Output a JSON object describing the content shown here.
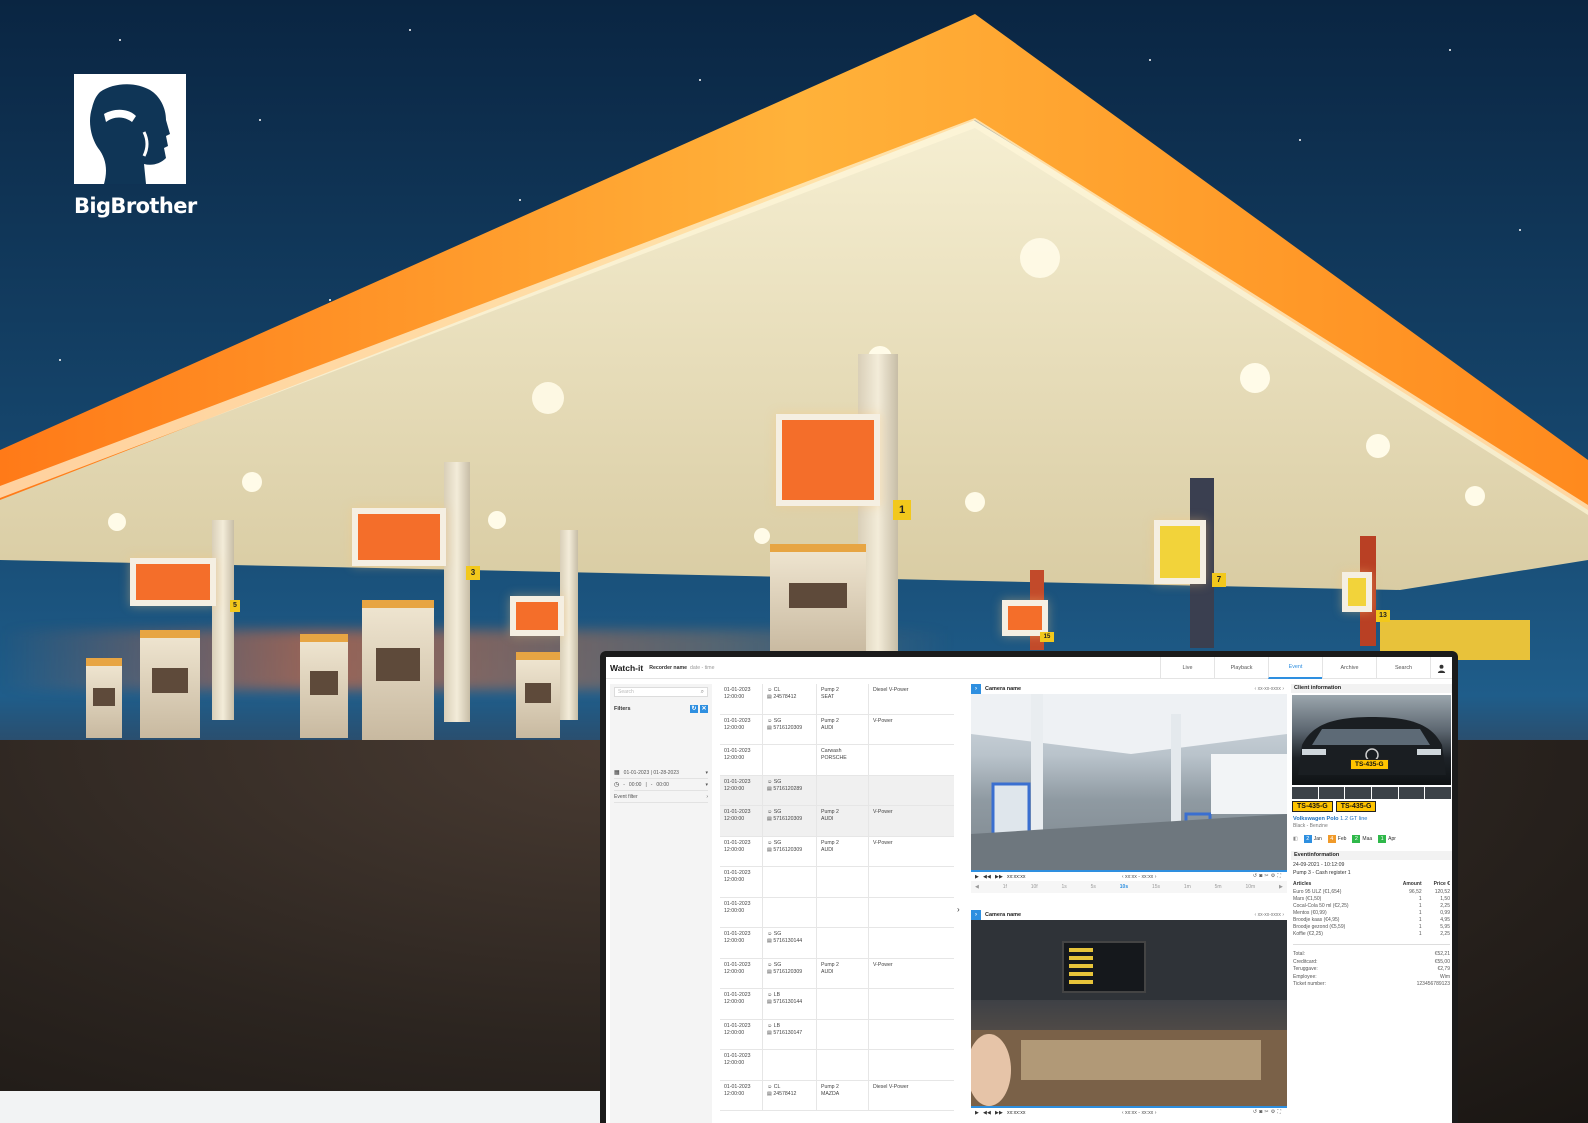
{
  "brand": {
    "logo_name": "BigBrother"
  },
  "scene": {
    "pump_numbers": [
      "1",
      "3",
      "7",
      "13",
      "15",
      "5"
    ]
  },
  "app": {
    "brand": "Watch-it",
    "recorder_name": "Recorder name",
    "recorder_datetime": "date - time",
    "nav": [
      {
        "label": "Live",
        "active": false
      },
      {
        "label": "Playback",
        "active": false
      },
      {
        "label": "Event",
        "active": true
      },
      {
        "label": "Archive",
        "active": false
      },
      {
        "label": "Search",
        "active": false
      }
    ],
    "accent_color": "#2e8fe0",
    "filters": {
      "search_placeholder": "Search",
      "title": "Filters",
      "date_range": "01-01-2023  |  01-28-2023",
      "time_from": "00:00",
      "time_to": "00:00",
      "event_filter": "Event filter"
    },
    "events": [
      {
        "date": "01-01-2023",
        "time": "12:00:00",
        "user": "CL",
        "id": "24578412",
        "pump": "Pump 2",
        "car": "SEAT",
        "fuel": "Diesel V-Power"
      },
      {
        "date": "01-01-2023",
        "time": "12:00:00",
        "user": "SG",
        "id": "5716120309",
        "pump": "Pump 2",
        "car": "AUDI",
        "fuel": "V-Power"
      },
      {
        "date": "01-01-2023",
        "time": "12:00:00",
        "user": "",
        "id": "",
        "pump": "Carwash",
        "car": "PORSCHE",
        "fuel": ""
      },
      {
        "date": "01-01-2023",
        "time": "12:00:00",
        "user": "SG",
        "id": "5716120289",
        "pump": "",
        "car": "",
        "fuel": ""
      },
      {
        "date": "01-01-2023",
        "time": "12:00:00",
        "user": "SG",
        "id": "5716120309",
        "pump": "Pump 2",
        "car": "AUDI",
        "fuel": "V-Power"
      },
      {
        "date": "01-01-2023",
        "time": "12:00:00",
        "user": "SG",
        "id": "5716120309",
        "pump": "Pump 2",
        "car": "AUDI",
        "fuel": "V-Power"
      },
      {
        "date": "01-01-2023",
        "time": "12:00:00",
        "user": "",
        "id": "",
        "pump": "",
        "car": "",
        "fuel": ""
      },
      {
        "date": "01-01-2023",
        "time": "12:00:00",
        "user": "",
        "id": "",
        "pump": "",
        "car": "",
        "fuel": ""
      },
      {
        "date": "01-01-2023",
        "time": "12:00:00",
        "user": "SG",
        "id": "5716130144",
        "pump": "",
        "car": "",
        "fuel": ""
      },
      {
        "date": "01-01-2023",
        "time": "12:00:00",
        "user": "SG",
        "id": "5716120309",
        "pump": "Pump 2",
        "car": "AUDI",
        "fuel": "V-Power"
      },
      {
        "date": "01-01-2023",
        "time": "12:00:00",
        "user": "LB",
        "id": "5716130144",
        "pump": "",
        "car": "",
        "fuel": ""
      },
      {
        "date": "01-01-2023",
        "time": "12:00:00",
        "user": "LB",
        "id": "5716130147",
        "pump": "",
        "car": "",
        "fuel": ""
      },
      {
        "date": "01-01-2023",
        "time": "12:00:00",
        "user": "",
        "id": "",
        "pump": "",
        "car": "",
        "fuel": ""
      },
      {
        "date": "01-01-2023",
        "time": "12:00:00",
        "user": "CL",
        "id": "24578412",
        "pump": "Pump 2",
        "car": "MAZDA",
        "fuel": "Diesel V-Power"
      }
    ],
    "cameras": [
      {
        "name": "Camera name",
        "nav_date": "xx-xx-xxxx",
        "time": "xx:xx:xx",
        "range": "xx:xx - xx:xx"
      },
      {
        "name": "Camera name",
        "nav_date": "xx-xx-xxxx",
        "time": "xx:xx:xx",
        "range": "xx:xx - xx:xx"
      }
    ],
    "scale": [
      "1f",
      "10f",
      "1s",
      "5s",
      "10s",
      "15s",
      "1m",
      "5m",
      "10m"
    ],
    "scale_active": "10s",
    "client": {
      "title": "Client information",
      "plate": "TS-435-G",
      "car_name": "Volkswagen Polo",
      "car_variant": "1.2 GT line",
      "car_sub": "Black - Benzine",
      "visits": [
        {
          "count": "2",
          "month": "Jan",
          "color": "#2e8fe0"
        },
        {
          "count": "4",
          "month": "Feb",
          "color": "#f09a2a"
        },
        {
          "count": "2",
          "month": "Maa",
          "color": "#2fb84a"
        },
        {
          "count": "1",
          "month": "Apr",
          "color": "#2fb84a"
        }
      ]
    },
    "event_info": {
      "title": "Eventinformation",
      "datetime": "24-09-2021 - 10:12:09",
      "location": "Pump 3 - Cash register 1",
      "col_articles": "Articles",
      "col_amount": "Amount",
      "col_price": "Price €",
      "articles": [
        {
          "name": "Euro 95 ULZ (€1,654)",
          "amount": "96,52",
          "price": "120,52"
        },
        {
          "name": "Mars (€1,50)",
          "amount": "1",
          "price": "1,50"
        },
        {
          "name": "Cocal-Cola 50 ml (€2,25)",
          "amount": "1",
          "price": "2,25"
        },
        {
          "name": "Mentos (€0,99)",
          "amount": "1",
          "price": "0,99"
        },
        {
          "name": "Broodje kaas (€4,95)",
          "amount": "1",
          "price": "4,95"
        },
        {
          "name": "Broodje gezond (€5,59)",
          "amount": "1",
          "price": "5,95"
        },
        {
          "name": "Koffie (€2,25)",
          "amount": "1",
          "price": "2,25"
        }
      ],
      "totals": [
        {
          "label": "Total:",
          "value": "€52,21"
        },
        {
          "label": "Creditcard:",
          "value": "€55,00"
        },
        {
          "label": "Teruggave:",
          "value": "€2,79"
        },
        {
          "label": "Employee:",
          "value": "Wim"
        },
        {
          "label": "Ticket number:",
          "value": "123456789123"
        }
      ]
    }
  }
}
